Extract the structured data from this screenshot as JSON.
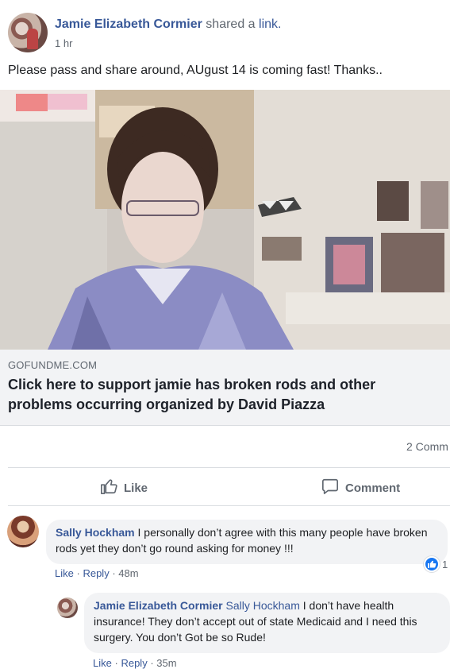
{
  "post": {
    "author": "Jamie Elizabeth Cormier",
    "shared_text": "shared a",
    "shared_link": "link.",
    "timestamp": "1 hr",
    "text": "Please pass and share around, AUgust 14 is coming fast! Thanks..",
    "link": {
      "domain": "GOFUNDME.COM",
      "title": "Click here to support jamie has broken rods and other problems occurring organized by David Piazza"
    },
    "comment_count": "2 Comm"
  },
  "actions": {
    "like_label": "Like",
    "comment_label": "Comment"
  },
  "comments": [
    {
      "author": "Sally Hockham",
      "text": "I personally don’t agree with this many people have broken rods yet they don’t go round asking for money !!!",
      "like": "Like",
      "reply": "Reply",
      "time": "48m",
      "sep": "·",
      "reaction_count": "1"
    },
    {
      "author": "Jamie Elizabeth Cormier",
      "mention": "Sally Hockham",
      "text": "I don’t have health insurance! They don’t accept out of state Medicaid and I need this surgery. You don’t Got be so Rude!",
      "like": "Like",
      "reply": "Reply",
      "time": "35m",
      "sep": "·"
    }
  ],
  "colors": {
    "link_blue": "#385898",
    "secondary_text": "#606770",
    "bubble_bg": "#f2f3f5",
    "like_blue": "#1877f2"
  }
}
